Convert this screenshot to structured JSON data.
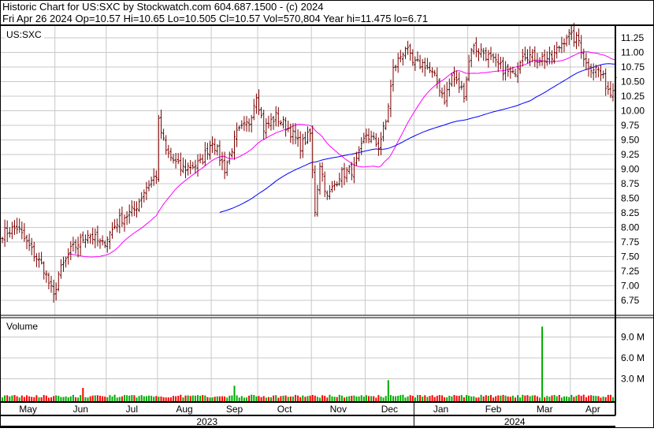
{
  "header": {
    "title": "Historic Chart for US:SXC by Stockwatch.com 604.687.1500 - (c) 2024",
    "quote": "Fri Apr 26 2024   Op=10.57   Hi=10.65   Lo=10.505   Cl=10.57   Vol=570,804   Year hi=11.475   lo=6.71"
  },
  "chart_data": {
    "type": "ohlc",
    "symbol": "US:SXC",
    "volume_label": "Volume",
    "price_ticks": [
      "6.75",
      "7.00",
      "7.25",
      "7.50",
      "7.75",
      "8.00",
      "8.25",
      "8.50",
      "8.75",
      "9.00",
      "9.25",
      "9.50",
      "9.75",
      "10.00",
      "10.25",
      "10.50",
      "10.75",
      "11.00",
      "11.25"
    ],
    "price_range": [
      6.5,
      11.45
    ],
    "volume_ticks": [
      "3.0 M",
      "6.0 M",
      "9.0 M"
    ],
    "volume_tick_values": [
      3000000,
      6000000,
      9000000
    ],
    "trading_days": 252,
    "months": [
      {
        "label": "May",
        "start": 0
      },
      {
        "label": "Jun",
        "start": 22
      },
      {
        "label": "Jul",
        "start": 43
      },
      {
        "label": "Aug",
        "start": 64
      },
      {
        "label": "Sep",
        "start": 86
      },
      {
        "label": "Oct",
        "start": 105
      },
      {
        "label": "Nov",
        "start": 127
      },
      {
        "label": "Dec",
        "start": 149
      },
      {
        "label": "Jan",
        "start": 169
      },
      {
        "label": "Feb",
        "start": 191
      },
      {
        "label": "Mar",
        "start": 212
      },
      {
        "label": "Apr",
        "start": 233
      }
    ],
    "years": [
      {
        "label": "2023",
        "start": 0
      },
      {
        "label": "2024",
        "start": 169
      }
    ],
    "close_waypoints": [
      [
        0,
        7.9
      ],
      [
        6,
        8.0
      ],
      [
        12,
        7.6
      ],
      [
        17,
        7.3
      ],
      [
        21,
        6.8
      ],
      [
        23,
        7.2
      ],
      [
        28,
        7.6
      ],
      [
        35,
        7.9
      ],
      [
        41,
        7.7
      ],
      [
        47,
        8.1
      ],
      [
        54,
        8.3
      ],
      [
        59,
        8.7
      ],
      [
        63,
        8.9
      ],
      [
        64,
        9.8
      ],
      [
        67,
        9.3
      ],
      [
        73,
        9.0
      ],
      [
        81,
        9.1
      ],
      [
        86,
        9.5
      ],
      [
        91,
        9.0
      ],
      [
        96,
        9.6
      ],
      [
        101,
        9.8
      ],
      [
        104,
        10.3
      ],
      [
        107,
        9.7
      ],
      [
        112,
        9.9
      ],
      [
        117,
        9.7
      ],
      [
        122,
        9.4
      ],
      [
        126,
        9.6
      ],
      [
        128,
        8.3
      ],
      [
        130,
        9.1
      ],
      [
        133,
        8.5
      ],
      [
        138,
        8.9
      ],
      [
        144,
        9.0
      ],
      [
        149,
        9.6
      ],
      [
        154,
        9.4
      ],
      [
        157,
        9.8
      ],
      [
        160,
        10.7
      ],
      [
        165,
        11.1
      ],
      [
        168,
        10.8
      ],
      [
        173,
        10.8
      ],
      [
        178,
        10.5
      ],
      [
        181,
        10.2
      ],
      [
        184,
        10.6
      ],
      [
        189,
        10.3
      ],
      [
        192,
        11.1
      ],
      [
        197,
        11.0
      ],
      [
        202,
        10.8
      ],
      [
        209,
        10.6
      ],
      [
        213,
        11.0
      ],
      [
        218,
        10.9
      ],
      [
        225,
        10.9
      ],
      [
        231,
        11.3
      ],
      [
        236,
        11.2
      ],
      [
        239,
        10.8
      ],
      [
        244,
        10.7
      ],
      [
        249,
        10.3
      ],
      [
        251,
        10.57
      ]
    ],
    "volume_base": 480000,
    "volume_spikes": [
      [
        33,
        1700000
      ],
      [
        95,
        2000000
      ],
      [
        158,
        2800000
      ],
      [
        221,
        10500000
      ]
    ],
    "ma_periods": [
      {
        "period": 28,
        "color": "#ff00ff"
      },
      {
        "period": 90,
        "color": "#0000ff"
      }
    ],
    "colors": {
      "up": "#00aa00",
      "down": "#ff0000",
      "ohlc": "#800000",
      "grid": "#c8c8c8"
    }
  }
}
